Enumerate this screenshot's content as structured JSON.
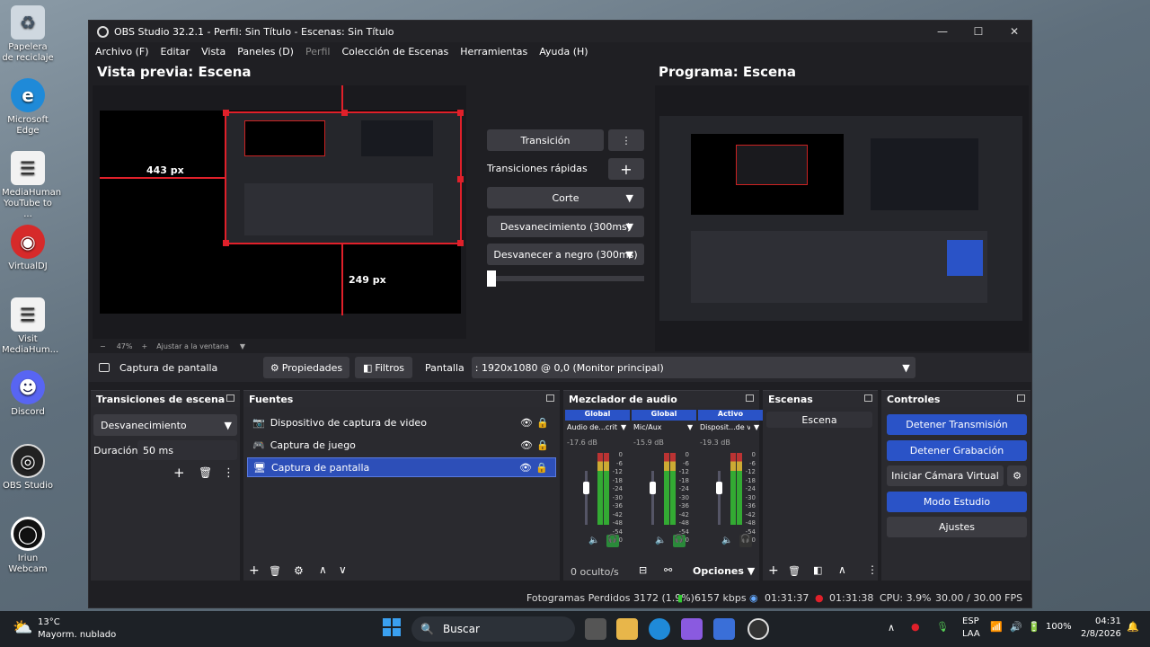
{
  "desktop": {
    "icons": [
      {
        "label": "Papelera de reciclaje",
        "icon": "recycle-bin-icon",
        "color": "#cfd8e0"
      },
      {
        "label": "Microsoft Edge",
        "icon": "edge-icon",
        "color": "#1f8ad8"
      },
      {
        "label": "MediaHuman YouTube to ...",
        "icon": "mediahuman-icon",
        "color": "#f2f2f2"
      },
      {
        "label": "VirtualDJ",
        "icon": "virtualdj-icon",
        "color": "#d62a2a"
      },
      {
        "label": "Visit MediaHum...",
        "icon": "mediahuman-visit-icon",
        "color": "#f2f2f2"
      },
      {
        "label": "Discord",
        "icon": "discord-icon",
        "color": "#5865f2"
      },
      {
        "label": "OBS Studio",
        "icon": "obs-icon",
        "color": "#222"
      },
      {
        "label": "Iriun Webcam",
        "icon": "iriun-icon",
        "color": "#111"
      }
    ]
  },
  "window": {
    "title": "OBS Studio 32.2.1 - Perfil: Sin Título - Escenas: Sin Título"
  },
  "menu": [
    "Archivo (F)",
    "Editar",
    "Vista",
    "Paneles (D)",
    "Perfil",
    "Colección de Escenas",
    "Herramientas",
    "Ayuda (H)"
  ],
  "preview": {
    "title": "Vista previa: Escena",
    "dim_left": "443 px",
    "dim_bottom": "249 px",
    "zoom": "47%",
    "fit": "Ajustar a la ventana"
  },
  "program": {
    "title": "Programa: Escena"
  },
  "transition_panel": {
    "transition": "Transición",
    "quick": "Transiciones rápidas",
    "b1": "Corte",
    "b2": "Desvanecimiento (300ms)",
    "b3": "Desvanecer a negro (300ms)"
  },
  "sourcebar": {
    "source": "Captura de pantalla",
    "properties": "Propiedades",
    "filters": "Filtros",
    "screen_label": "Pantalla",
    "screen_value": ": 1920x1080 @ 0,0 (Monitor principal)"
  },
  "docks": {
    "transitions": {
      "title": "Transiciones de escena",
      "selected": "Desvanecimiento",
      "duration_label": "Duración",
      "duration": "50 ms"
    },
    "sources": {
      "title": "Fuentes",
      "items": [
        "Dispositivo de captura de video",
        "Captura de juego",
        "Captura de pantalla"
      ]
    },
    "mixer": {
      "title": "Mezclador de audio",
      "channels": [
        {
          "tag": "Global",
          "name": "Audio de...critorio",
          "db": "-17.6 dB"
        },
        {
          "tag": "Global",
          "name": "Mic/Aux",
          "db": "-15.9 dB"
        },
        {
          "tag": "Activo",
          "name": "Disposit...de vid",
          "db": "-19.3 dB"
        }
      ],
      "scale": [
        "0",
        "-6",
        "-12",
        "-18",
        "-24",
        "-30",
        "-36",
        "-42",
        "-48",
        "-54",
        "-60"
      ],
      "hidden": "0 oculto/s",
      "options": "Opciones"
    },
    "scenes": {
      "title": "Escenas",
      "items": [
        "Escena"
      ]
    },
    "controls": {
      "title": "Controles",
      "stream": "Detener Transmisión",
      "record": "Detener Grabación",
      "vcam": "Iniciar Cámara Virtual",
      "studio": "Modo Estudio",
      "settings": "Ajustes"
    }
  },
  "status": {
    "dropped": "Fotogramas Perdidos 3172 (1.9%)",
    "kbps": "6157 kbps",
    "stream_time": "01:31:37",
    "rec_time": "01:31:38",
    "cpu": "CPU: 3.9%",
    "fps": "30.00 / 30.00 FPS"
  },
  "taskbar": {
    "temp": "13°C",
    "weather": "Mayorm. nublado",
    "search": "Buscar",
    "lang1": "ESP",
    "lang2": "LAA",
    "battery": "100%",
    "time": "04:31",
    "date": "2/8/2026"
  },
  "colors": {
    "accent": "#2a53c7",
    "selected": "#2d4fb8",
    "red": "#e0202a"
  }
}
